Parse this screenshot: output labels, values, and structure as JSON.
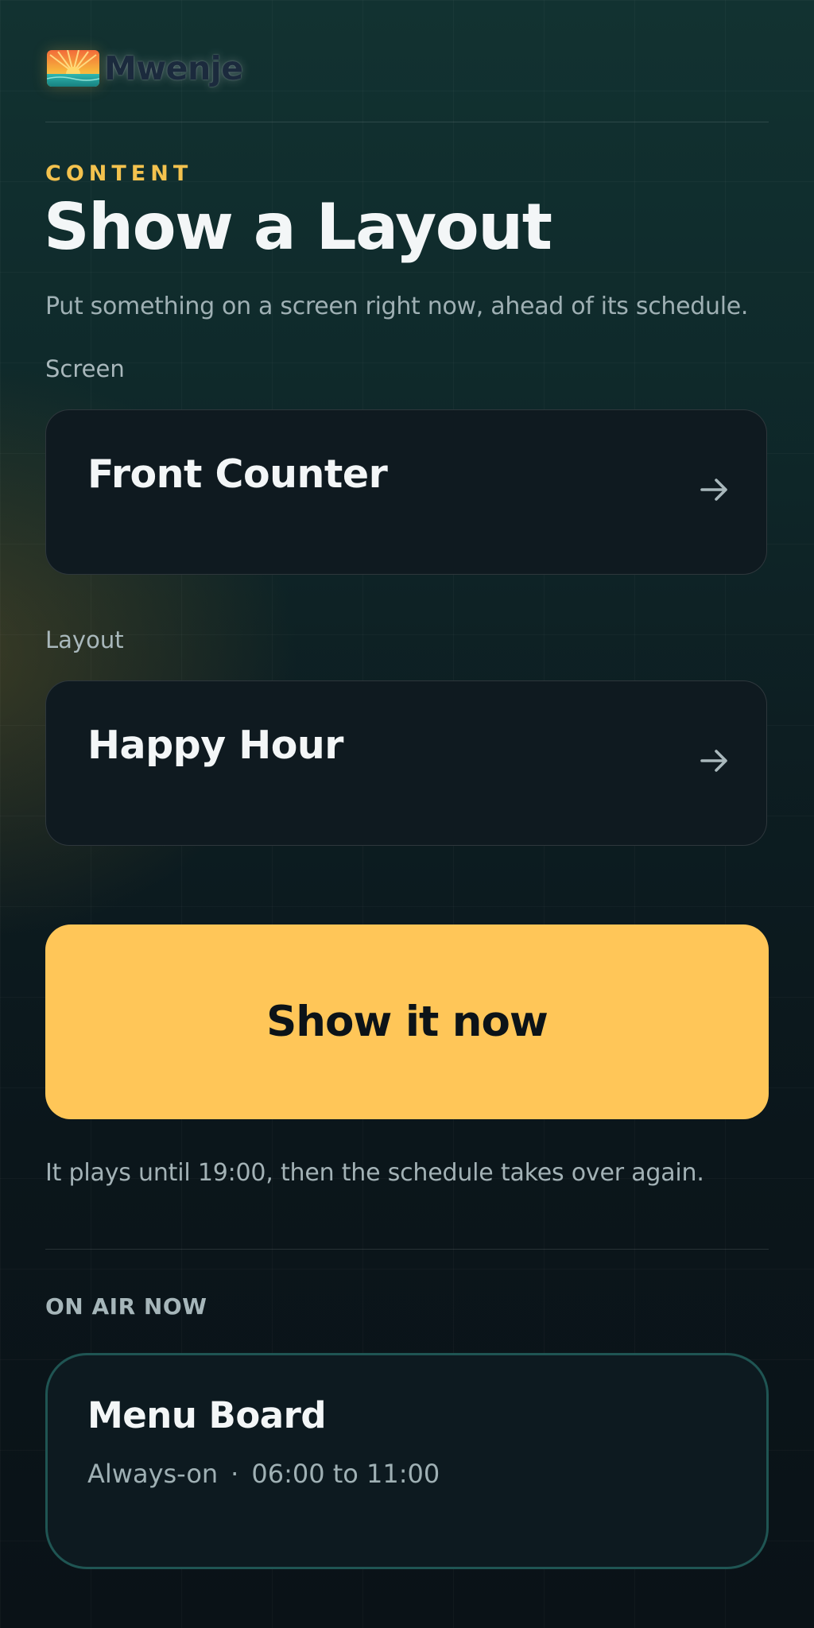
{
  "brand": {
    "name": "Mwenje",
    "logo_icon": "sunrise-logo-icon"
  },
  "header": {
    "eyebrow": "CONTENT",
    "title": "Show a Layout",
    "subtitle": "Put something on a screen right now, ahead of its schedule."
  },
  "form": {
    "screen": {
      "label": "Screen",
      "value": "Front Counter",
      "icon": "arrow-right-icon"
    },
    "layout": {
      "label": "Layout",
      "value": "Happy Hour",
      "icon": "arrow-right-icon"
    },
    "submit_label": "Show it now",
    "note": "It plays until 19:00, then the schedule takes over again."
  },
  "on_air": {
    "section_label": "ON AIR NOW",
    "title": "Menu Board",
    "mode": "Always-on",
    "separator": "·",
    "time_range": "06:00 to 11:00"
  },
  "colors": {
    "accent": "#ffc658",
    "eyebrow": "#f3c24e",
    "card_border": "#1f5553",
    "background": "#0d1e22"
  }
}
